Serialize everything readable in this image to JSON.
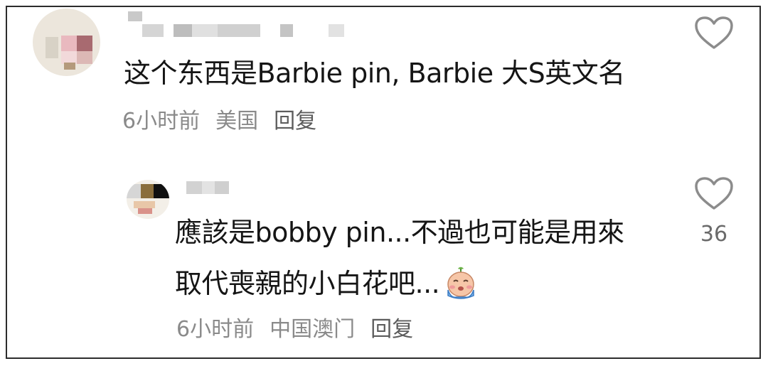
{
  "comments": [
    {
      "text": "这个东西是Barbie pin, Barbie 大S英文名",
      "time": "6小时前",
      "location": "美国",
      "reply_label": "回复"
    },
    {
      "text_line1": "應該是bobby pin...不過也可能是用來",
      "text_line2": "取代喪親的小白花吧...",
      "time": "6小时前",
      "location": "中国澳门",
      "reply_label": "回复",
      "like_count": "36",
      "emoji": "crying-face-emoji"
    }
  ],
  "icons": {
    "like": "heart-outline-icon"
  },
  "colors": {
    "text": "#151515",
    "meta": "#8a8a8a",
    "heart_stroke": "#8c8c8c"
  }
}
